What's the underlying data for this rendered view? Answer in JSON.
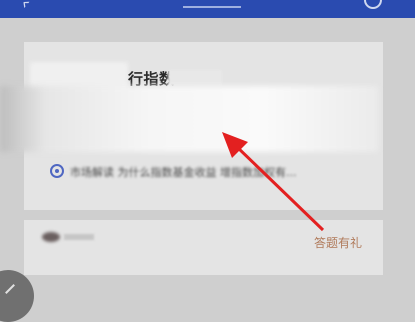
{
  "header": {
    "back_icon": "chevron-left-icon",
    "right_icon": "circle-icon"
  },
  "card1": {
    "title_text": "行指数",
    "subitem_text": "市场解读  为什么指数基金收益  增指数加权有..."
  },
  "card2": {
    "action_label": "答题有礼"
  },
  "annotation": {
    "arrow_color": "#e32020"
  },
  "colors": {
    "header_bg": "#2a4bb0",
    "accent": "#4f67c2",
    "quiz_text": "#b07a5a"
  }
}
